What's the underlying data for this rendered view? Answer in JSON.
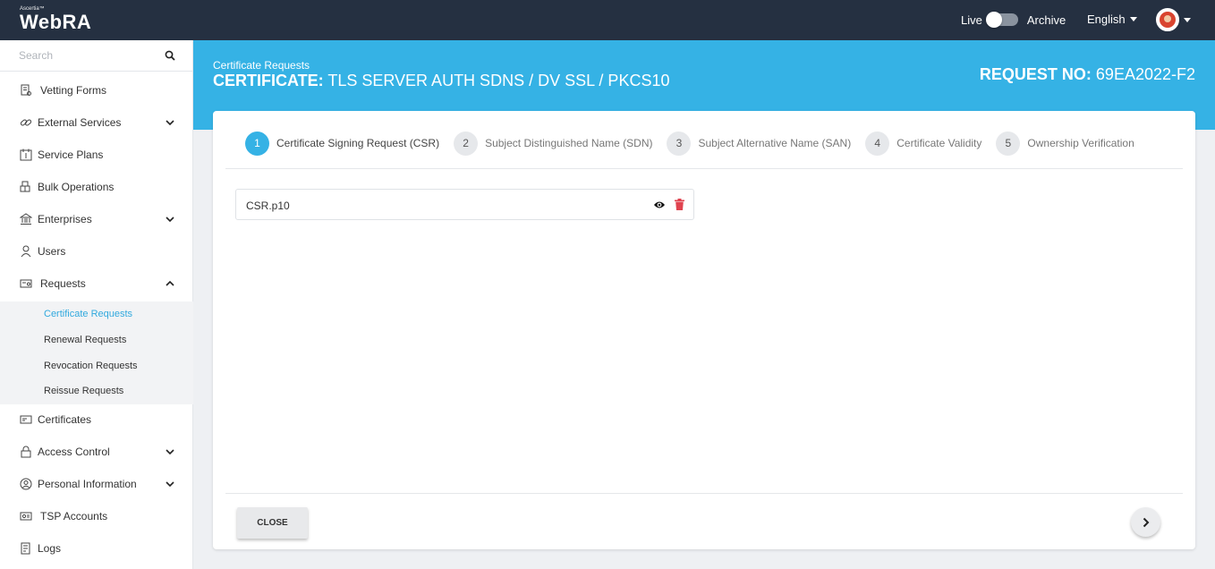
{
  "app": {
    "brand_small": "Ascertia™",
    "brand_name": "WebRA",
    "live_label": "Live",
    "archive_label": "Archive",
    "language": "English"
  },
  "sidebar": {
    "search_placeholder": "Search",
    "items": [
      {
        "label": "Vetting Forms",
        "icon": "vetting-forms-icon"
      },
      {
        "label": "External Services",
        "icon": "link-icon"
      },
      {
        "label": "Service Plans",
        "icon": "service-plans-icon"
      },
      {
        "label": "Bulk Operations",
        "icon": "bulk-operations-icon"
      },
      {
        "label": "Enterprises",
        "icon": "enterprise-icon"
      },
      {
        "label": "Users",
        "icon": "users-icon"
      },
      {
        "label": "Requests",
        "icon": "requests-icon"
      },
      {
        "label": "Certificates",
        "icon": "certificate-icon"
      },
      {
        "label": "Access Control",
        "icon": "lock-icon"
      },
      {
        "label": "Personal Information",
        "icon": "person-icon"
      },
      {
        "label": "TSP Accounts",
        "icon": "tsp-accounts-icon"
      },
      {
        "label": "Logs",
        "icon": "logs-icon"
      }
    ],
    "request_subitems": [
      {
        "label": "Certificate Requests",
        "active": true
      },
      {
        "label": "Renewal Requests",
        "active": false
      },
      {
        "label": "Revocation Requests",
        "active": false
      },
      {
        "label": "Reissue Requests",
        "active": false
      }
    ]
  },
  "header": {
    "breadcrumb": "Certificate Requests",
    "cert_prefix": "CERTIFICATE:",
    "cert_value": "TLS SERVER AUTH SDNS / DV SSL / PKCS10",
    "request_prefix": "REQUEST NO:",
    "request_value": "69EA2022-F2"
  },
  "wizard": {
    "steps": [
      {
        "num": "1",
        "label": "Certificate Signing Request (CSR)",
        "active": true
      },
      {
        "num": "2",
        "label": "Subject Distinguished Name (SDN)",
        "active": false
      },
      {
        "num": "3",
        "label": "Subject Alternative Name (SAN)",
        "active": false
      },
      {
        "num": "4",
        "label": "Certificate Validity",
        "active": false
      },
      {
        "num": "5",
        "label": "Ownership Verification",
        "active": false
      }
    ],
    "file_name": "CSR.p10",
    "close_label": "CLOSE"
  },
  "colors": {
    "topbar": "#253041",
    "accent": "#35b2e5",
    "danger": "#e0434f"
  }
}
